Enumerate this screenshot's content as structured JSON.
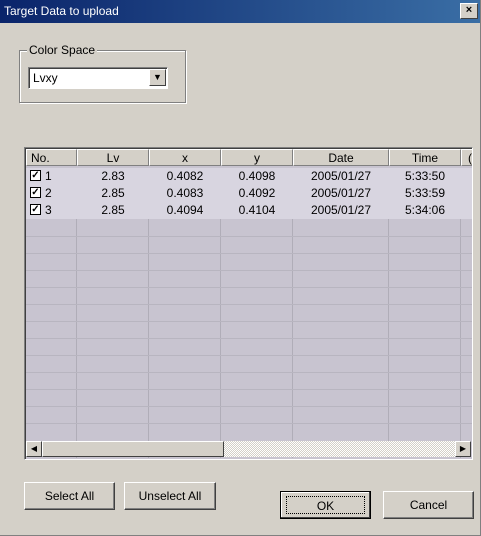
{
  "window": {
    "title": "Target Data to upload",
    "close_glyph": "×"
  },
  "color_space": {
    "group_label": "Color Space",
    "selected": "Lvxy",
    "arrow_glyph": "▼"
  },
  "table": {
    "columns": [
      "No.",
      "Lv",
      "x",
      "y",
      "Date",
      "Time",
      "("
    ],
    "rows": [
      {
        "checked": true,
        "no": "1",
        "lv": "2.83",
        "x": "0.4082",
        "y": "0.4098",
        "date": "2005/01/27",
        "time": "5:33:50"
      },
      {
        "checked": true,
        "no": "2",
        "lv": "2.85",
        "x": "0.4083",
        "y": "0.4092",
        "date": "2005/01/27",
        "time": "5:33:59"
      },
      {
        "checked": true,
        "no": "3",
        "lv": "2.85",
        "x": "0.4094",
        "y": "0.4104",
        "date": "2005/01/27",
        "time": "5:34:06"
      }
    ],
    "check_glyph": "✓"
  },
  "scrollbar": {
    "left_glyph": "◀",
    "right_glyph": "▶"
  },
  "buttons": {
    "select_all": "Select All",
    "unselect_all": "Unselect All",
    "ok": "OK",
    "cancel": "Cancel"
  }
}
